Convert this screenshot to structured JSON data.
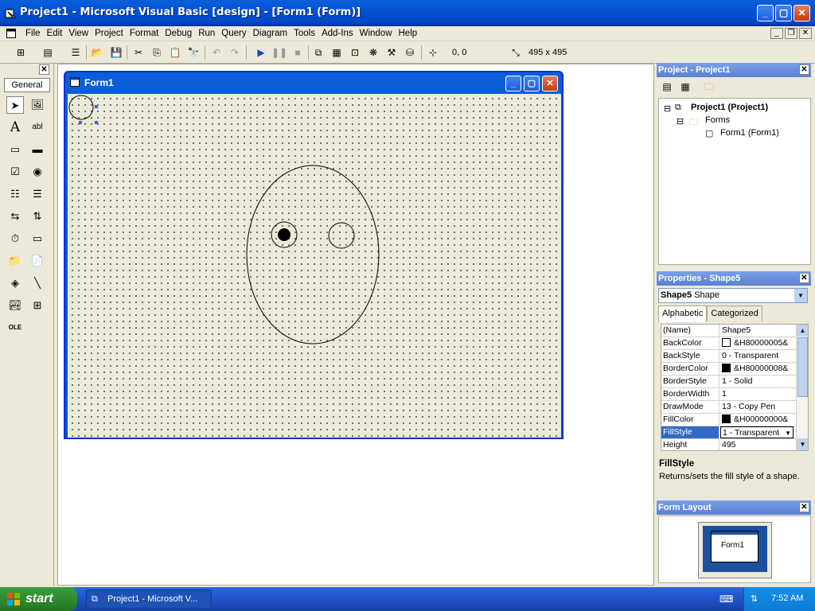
{
  "window": {
    "title": "Project1 - Microsoft Visual Basic [design] - [Form1 (Form)]"
  },
  "menu": [
    "File",
    "Edit",
    "View",
    "Project",
    "Format",
    "Debug",
    "Run",
    "Query",
    "Diagram",
    "Tools",
    "Add-Ins",
    "Window",
    "Help"
  ],
  "toolbar": {
    "position": "0, 0",
    "size": "495 x 495"
  },
  "toolbox": {
    "tab_label": "General"
  },
  "form": {
    "title": "Form1"
  },
  "project": {
    "panel_title": "Project - Project1",
    "tree": {
      "root": "Project1 (Project1)",
      "folder": "Forms",
      "item": "Form1 (Form1)"
    }
  },
  "properties": {
    "panel_title": "Properties - Shape5",
    "object_name": "Shape5",
    "object_type": "Shape",
    "tabs": [
      "Alphabetic",
      "Categorized"
    ],
    "rows": [
      {
        "name": "(Name)",
        "value": "Shape5"
      },
      {
        "name": "BackColor",
        "value": "&H80000005&"
      },
      {
        "name": "BackStyle",
        "value": "0 - Transparent"
      },
      {
        "name": "BorderColor",
        "value": "&H80000008&"
      },
      {
        "name": "BorderStyle",
        "value": "1 - Solid"
      },
      {
        "name": "BorderWidth",
        "value": "1"
      },
      {
        "name": "DrawMode",
        "value": "13 - Copy Pen"
      },
      {
        "name": "FillColor",
        "value": "&H00000000&"
      },
      {
        "name": "FillStyle",
        "value": "1 - Transparent"
      },
      {
        "name": "Height",
        "value": "495"
      }
    ],
    "description_title": "FillStyle",
    "description_text": "Returns/sets the fill style of a shape."
  },
  "form_layout": {
    "panel_title": "Form Layout",
    "preview_label": "Form1"
  },
  "taskbar": {
    "start_label": "start",
    "task_label": "Project1 - Microsoft V...",
    "clock": "7:52 AM"
  },
  "colors": {
    "title_blue": "#0453d4",
    "selection_blue": "#316ac5",
    "start_green": "#2e8b2e"
  }
}
